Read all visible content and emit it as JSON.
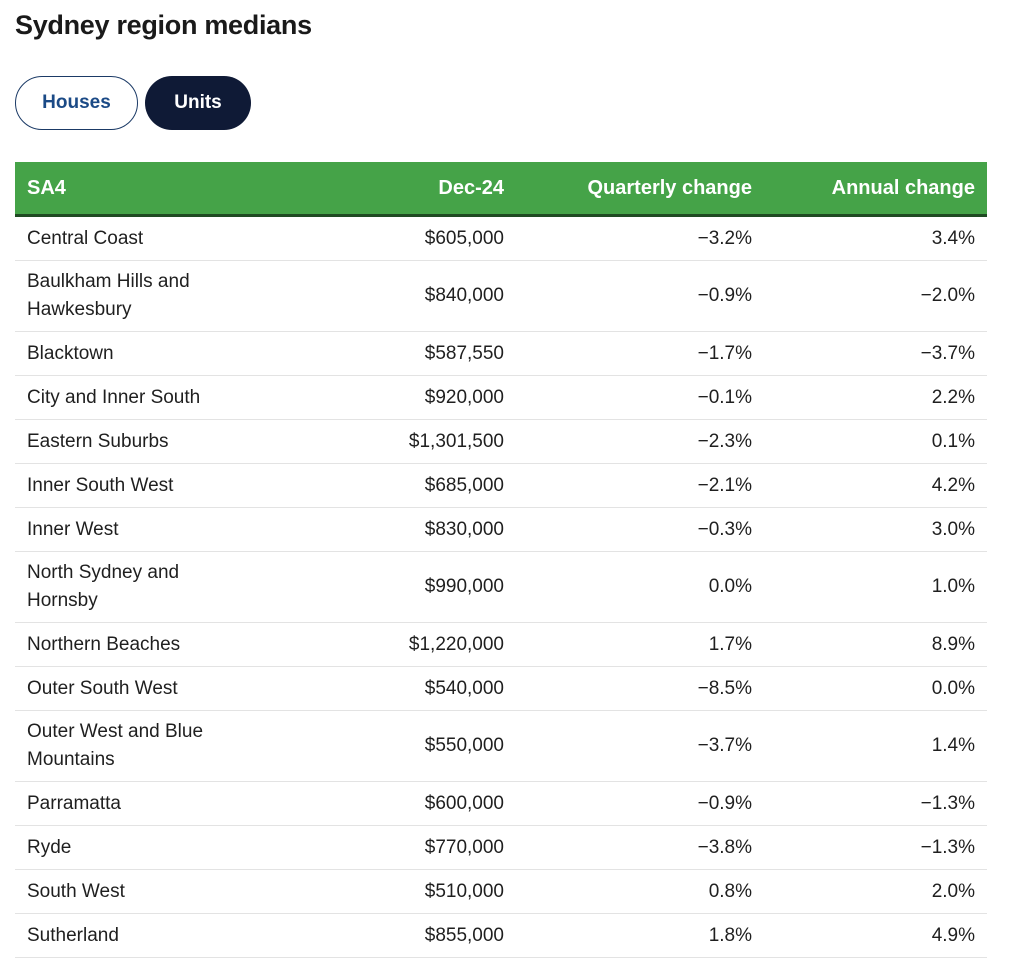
{
  "title": "Sydney region medians",
  "toggles": {
    "houses": "Houses",
    "units": "Units",
    "selected": "Units"
  },
  "colors": {
    "header_bg": "#45a348",
    "selected_toggle": "#0f1a36",
    "toggle_text": "#1b4a86"
  },
  "table": {
    "headers": [
      "SA4",
      "Dec-24",
      "Quarterly change",
      "Annual change"
    ],
    "rows": [
      [
        "Central Coast",
        "$605,000",
        "−3.2%",
        "3.4%"
      ],
      [
        "Baulkham Hills and Hawkesbury",
        "$840,000",
        "−0.9%",
        "−2.0%"
      ],
      [
        "Blacktown",
        "$587,550",
        "−1.7%",
        "−3.7%"
      ],
      [
        "City and Inner South",
        "$920,000",
        "−0.1%",
        "2.2%"
      ],
      [
        "Eastern Suburbs",
        "$1,301,500",
        "−2.3%",
        "0.1%"
      ],
      [
        "Inner South West",
        "$685,000",
        "−2.1%",
        "4.2%"
      ],
      [
        "Inner West",
        "$830,000",
        "−0.3%",
        "3.0%"
      ],
      [
        "North Sydney and Hornsby",
        "$990,000",
        "0.0%",
        "1.0%"
      ],
      [
        "Northern Beaches",
        "$1,220,000",
        "1.7%",
        "8.9%"
      ],
      [
        "Outer South West",
        "$540,000",
        "−8.5%",
        "0.0%"
      ],
      [
        "Outer West and Blue Mountains",
        "$550,000",
        "−3.7%",
        "1.4%"
      ],
      [
        "Parramatta",
        "$600,000",
        "−0.9%",
        "−1.3%"
      ],
      [
        "Ryde",
        "$770,000",
        "−3.8%",
        "−1.3%"
      ],
      [
        "South West",
        "$510,000",
        "0.8%",
        "2.0%"
      ],
      [
        "Sutherland",
        "$855,000",
        "1.8%",
        "4.9%"
      ]
    ]
  }
}
